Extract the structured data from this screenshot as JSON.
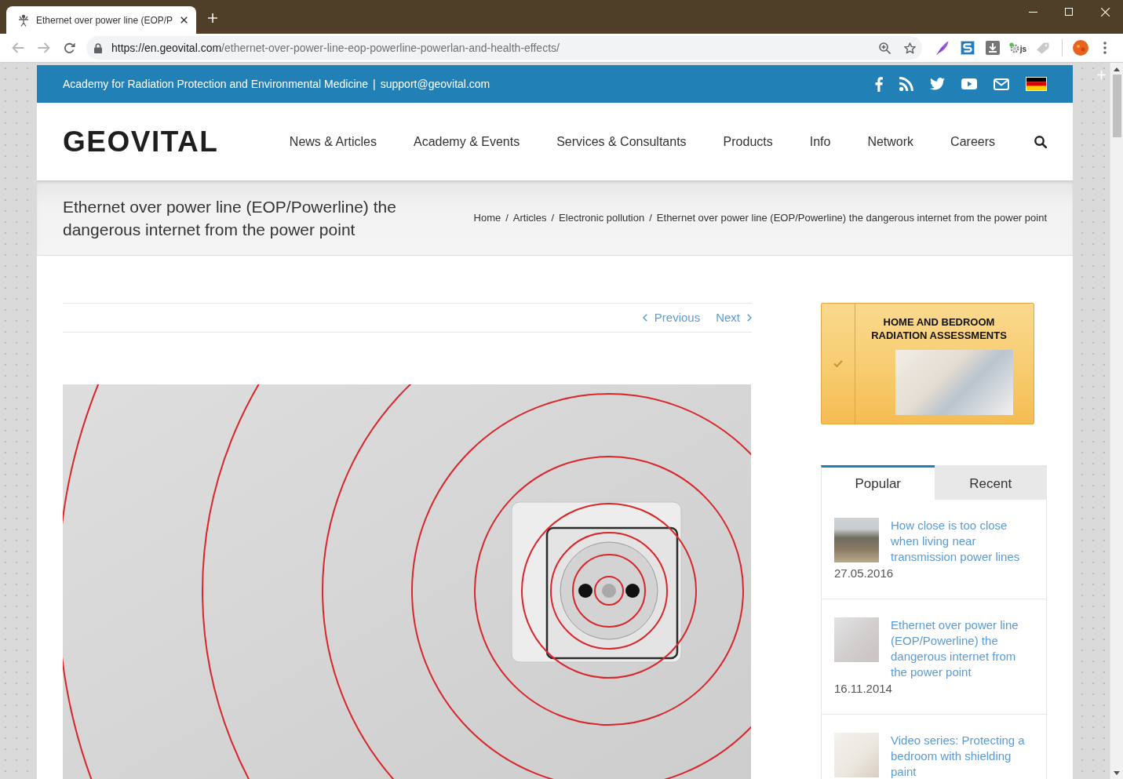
{
  "browser": {
    "tab": {
      "title": "Ethernet over power line (EOP/P",
      "selected": true
    },
    "back": {
      "disabled": true
    },
    "forward": {
      "disabled": true
    },
    "address": {
      "host": "https://en.geovital.com",
      "path": "/ethernet-over-power-line-eop-powerline-powerlan-and-health-effects/"
    },
    "extension_label": "js"
  },
  "top_bar": {
    "tagline": "Academy for Radiation Protection and Environmental Medicine",
    "separator": "|",
    "email": "support@geovital.com"
  },
  "header": {
    "logo": "GEOVITAL",
    "nav": [
      "News & Articles",
      "Academy & Events",
      "Services & Consultants",
      "Products",
      "Info",
      "Network",
      "Careers"
    ]
  },
  "title_bar": {
    "title": "Ethernet over power line (EOP/Powerline) the dangerous internet from the power point",
    "breadcrumb": [
      {
        "label": "Home",
        "separator": "/"
      },
      {
        "label": "Articles",
        "separator": "/"
      },
      {
        "label": "Electronic pollution",
        "separator": "/"
      },
      {
        "label": "Ethernet over power line (EOP/Powerline) the dangerous internet from the power point"
      }
    ]
  },
  "post_nav": {
    "previous": "Previous",
    "next": "Next"
  },
  "sidebar": {
    "promo": {
      "title_lines": [
        "HOME AND BEDROOM",
        "RADIATION ASSESSMENTS"
      ]
    },
    "tabs": [
      {
        "label": "Popular",
        "selected": true
      },
      {
        "label": "Recent",
        "selected": false
      }
    ],
    "posts": [
      {
        "title": "How close is too close when living near transmission power lines",
        "date": "27.05.2016"
      },
      {
        "title": "Ethernet over power line (EOP/Powerline) the dangerous internet from the power point",
        "date": "16.11.2014"
      },
      {
        "title": "Video series: Protecting a bedroom with shielding paint"
      }
    ]
  }
}
